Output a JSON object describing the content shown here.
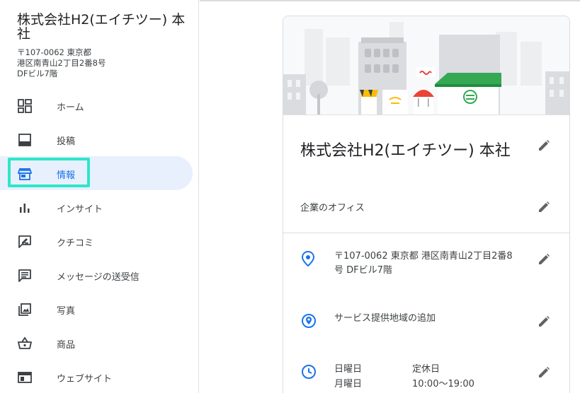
{
  "business": {
    "name": "株式会社H2(エイチツー) 本社",
    "address_lines": [
      "〒107-0062 東京都",
      "港区南青山2丁目2番8号",
      "DFビル7階"
    ]
  },
  "nav": {
    "items": [
      {
        "label": "ホーム",
        "icon": "dashboard-icon"
      },
      {
        "label": "投稿",
        "icon": "posts-icon"
      },
      {
        "label": "情報",
        "icon": "storefront-icon",
        "active": true
      },
      {
        "label": "インサイト",
        "icon": "insights-icon"
      },
      {
        "label": "クチコミ",
        "icon": "reviews-icon"
      },
      {
        "label": "メッセージの送受信",
        "icon": "message-icon"
      },
      {
        "label": "写真",
        "icon": "photo-icon"
      },
      {
        "label": "商品",
        "icon": "basket-icon"
      },
      {
        "label": "ウェブサイト",
        "icon": "website-icon"
      }
    ]
  },
  "card": {
    "title": "株式会社H2(エイチツー) 本社",
    "category": "企業のオフィス",
    "address": "〒107-0062 東京都 港区南青山2丁目2番8号 DFビル7階",
    "service_area": "サービス提供地域の追加",
    "hours": [
      {
        "day": "日曜日",
        "time": "定休日"
      },
      {
        "day": "月曜日",
        "time": "10:00～19:00"
      }
    ]
  },
  "colors": {
    "accent": "#1a73e8",
    "active_bg": "#e8f0fe",
    "highlight": "#2ee6c8",
    "icon_gray": "#5f6368"
  }
}
